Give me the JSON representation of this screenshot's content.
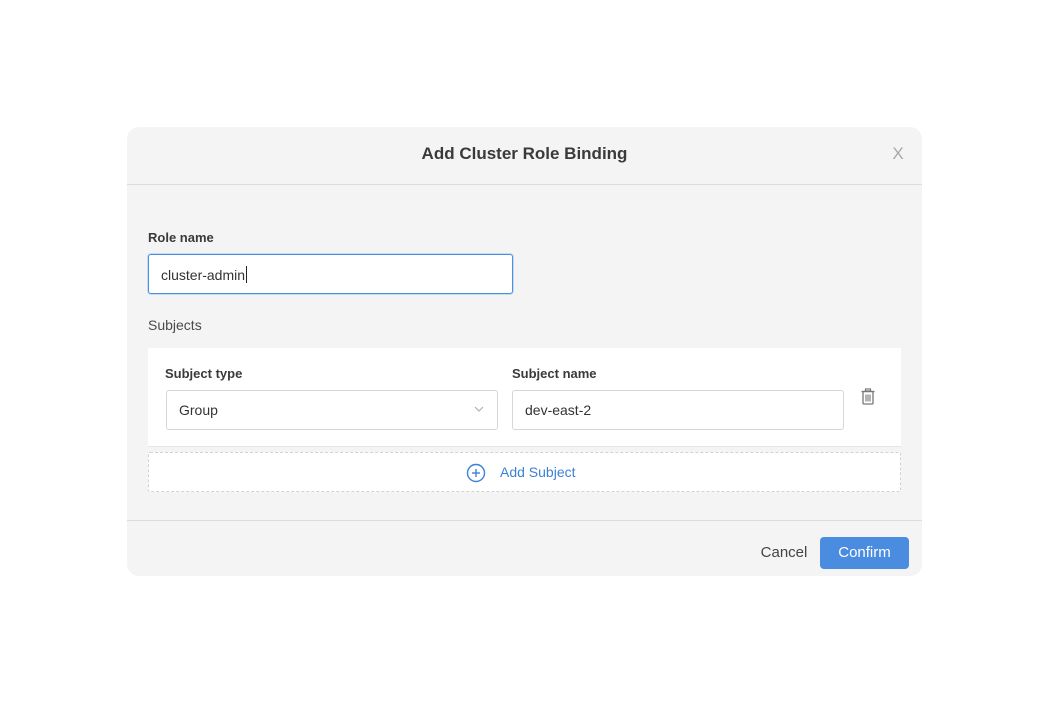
{
  "dialog": {
    "title": "Add Cluster Role Binding",
    "close_label": "X"
  },
  "role": {
    "label": "Role name",
    "value": "cluster-admin"
  },
  "subjects": {
    "title": "Subjects",
    "items": [
      {
        "type_label": "Subject type",
        "type_value": "Group",
        "name_label": "Subject name",
        "name_value": "dev-east-2"
      }
    ],
    "add_label": "Add Subject"
  },
  "footer": {
    "cancel_label": "Cancel",
    "confirm_label": "Confirm"
  },
  "colors": {
    "accent": "#4a8ce0",
    "link": "#3b82d6",
    "dialog_bg": "#f4f4f4"
  },
  "icons": {
    "close": "close-icon",
    "chevron": "chevron-down-icon",
    "delete": "trash-icon",
    "add": "plus-circle-icon"
  }
}
